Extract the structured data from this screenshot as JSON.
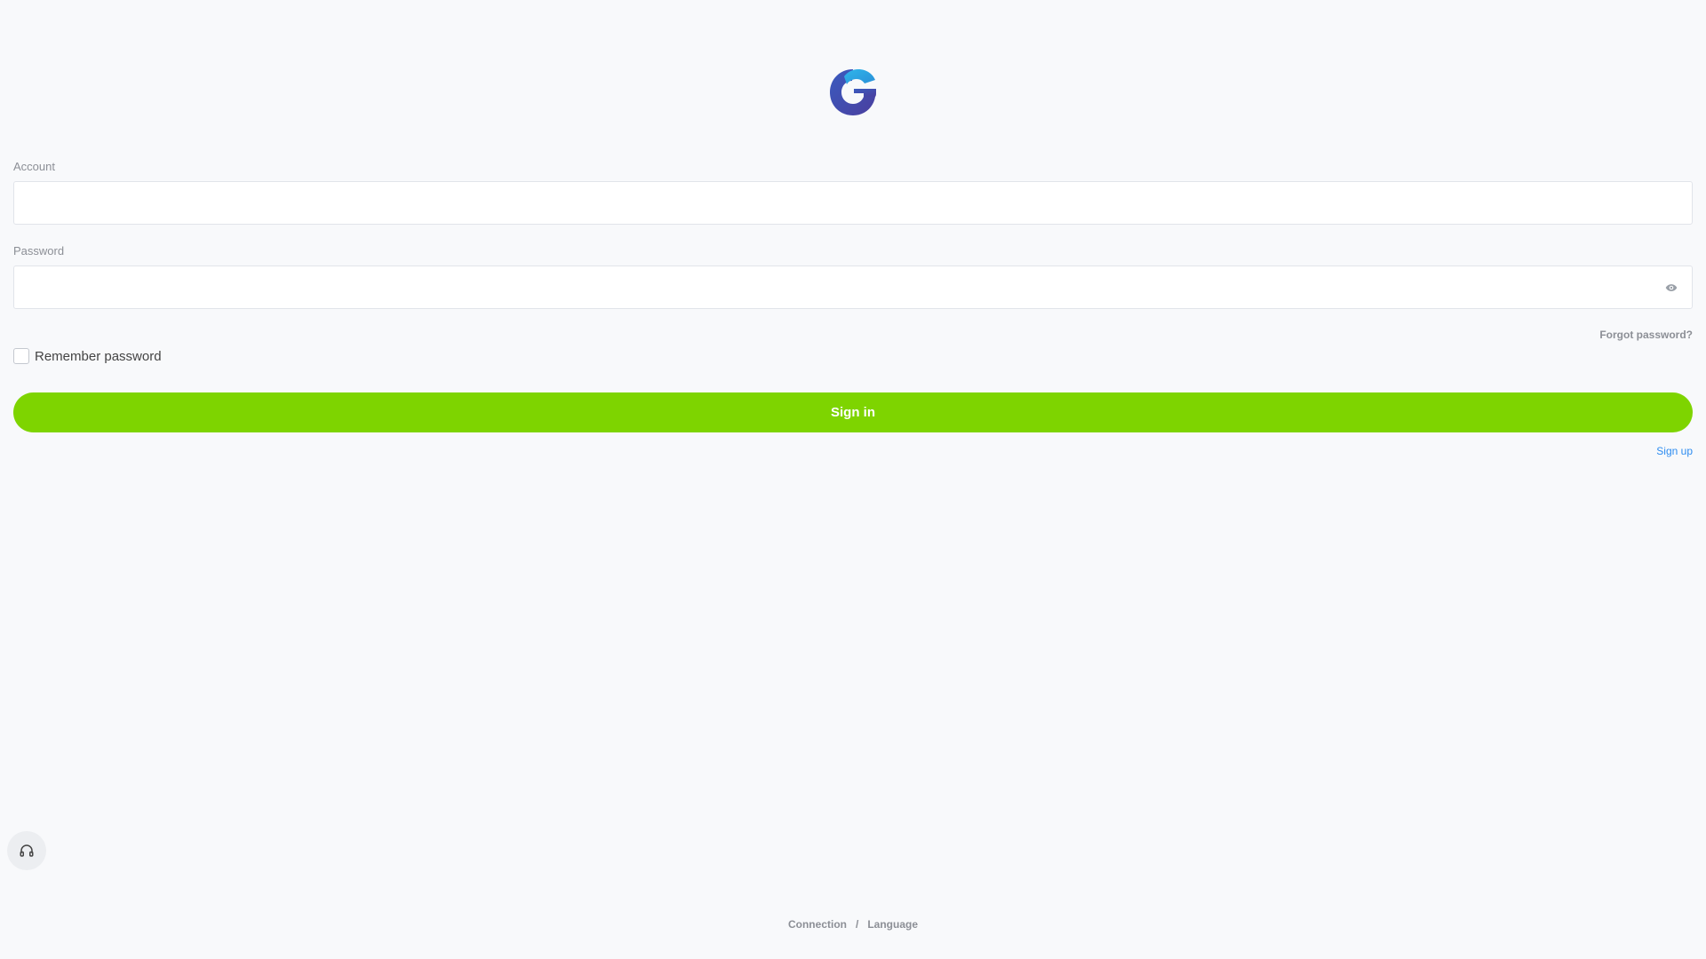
{
  "logo": {
    "icon": "brand-logo-icon",
    "colors": [
      "#2fb6ea",
      "#3a5bbf",
      "#4a3f9f"
    ]
  },
  "form": {
    "account_label": "Account",
    "account_value": "",
    "password_label": "Password",
    "password_value": "",
    "forgot_label": "Forgot password?",
    "remember_label": "Remember password",
    "remember_checked": false,
    "signin_label": "Sign in",
    "signup_label": "Sign up"
  },
  "support": {
    "icon": "headset-icon"
  },
  "footer": {
    "connection_label": "Connection",
    "separator": "/",
    "language_label": "Language"
  },
  "colors": {
    "primary": "#7ed400",
    "link": "#2d8cf0",
    "muted": "#8c8f96",
    "background": "#f8f9fb"
  }
}
